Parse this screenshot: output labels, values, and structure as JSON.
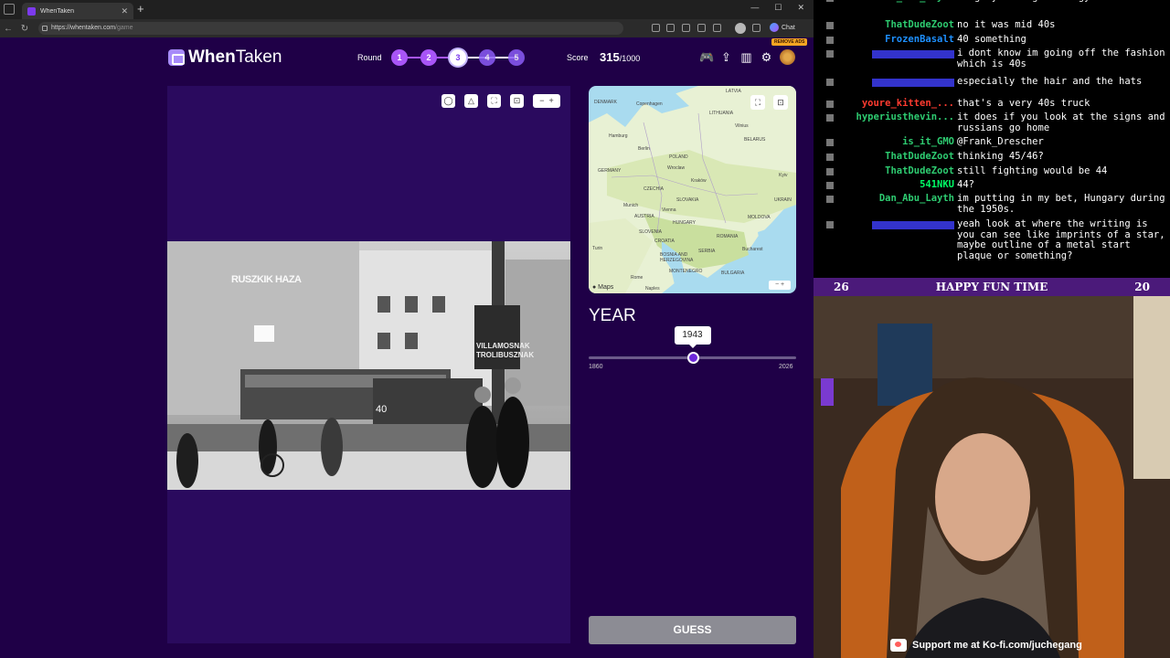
{
  "browser": {
    "tab_title": "WhenTaken",
    "url_prefix": "https://whentaken.com",
    "url_path": "/game",
    "chat_label": "Chat",
    "remove_ads": "REMOVE ADS"
  },
  "header": {
    "logo_bold": "When",
    "logo_light": "Taken",
    "round_label": "Round",
    "rounds": [
      "1",
      "2",
      "3",
      "4",
      "5"
    ],
    "current_round": 3,
    "score_label": "Score",
    "score_value": "315",
    "score_max": "/1000"
  },
  "photo": {
    "sign_top": "RUSZKIK HAZA",
    "sign_shop": "VILLAMOSNAK TROLIBUSZNAK",
    "tram_text": "40"
  },
  "map": {
    "attribution": " Maps",
    "labels": [
      "Copenhagen",
      "LATVIA",
      "LITHUANIA",
      "Hamburg",
      "Berlin",
      "BELARUS",
      "POLAND",
      "GERMANY",
      "Wroclaw",
      "Kraków",
      "CZECHIA",
      "Kyiv",
      "Munich",
      "SLOVAKIA",
      "Vienna",
      "UKRAIN",
      "AUSTRIA",
      "HUNGARY",
      "MOLDOVA",
      "SLOVENIA",
      "CROATIA",
      "ROMANIA",
      "Turin",
      "BOSNIA AND HERZEGOVINA",
      "SERBIA",
      "Bucharest",
      "Rome",
      "MONTENEGRO",
      "BULGARIA",
      "Naples",
      "DENMARK",
      "Vilnius"
    ]
  },
  "year": {
    "label": "YEAR",
    "selected": "1943",
    "min": "1860",
    "max": "2026",
    "value_fraction": 0.5
  },
  "guess_label": "GUESS",
  "stream": {
    "chat": [
      {
        "user": "Dan_Abu_Layth",
        "color": "#2ecc71",
        "text": "Hungary during the Nagy Years?"
      },
      {
        "user": "ThatDudeZoot",
        "color": "#2ecc71",
        "text": "no it was mid 40s"
      },
      {
        "user": "FrozenBasalt",
        "color": "#1e90ff",
        "text": "40 something"
      },
      {
        "user": "",
        "color": "#3333cc",
        "text": "i dont know im going off the fashion which is 40s"
      },
      {
        "user": "",
        "color": "#3333cc",
        "text": "especially the hair and the hats"
      },
      {
        "user": "youre_kitten_...",
        "color": "#ff3b30",
        "text": "that's a very 40s truck"
      },
      {
        "user": "hyperiusthevin...",
        "color": "#2ecc71",
        "text": "it does if you look at the signs and russians go home"
      },
      {
        "user": "is_it_GMO",
        "color": "#2ecc71",
        "text": "@Frank_Drescher"
      },
      {
        "user": "ThatDudeZoot",
        "color": "#2ecc71",
        "text": "thinking 45/46?"
      },
      {
        "user": "ThatDudeZoot",
        "color": "#2ecc71",
        "text": "still fighting would be 44"
      },
      {
        "user": "541NKU",
        "color": "#00ff66",
        "text": "44?"
      },
      {
        "user": "Dan_Abu_Layth",
        "color": "#2ecc71",
        "text": "im putting in my bet, Hungary during the 1950s."
      },
      {
        "user": "",
        "color": "#3333cc",
        "text": "yeah look at where the writing is you can see like imprints of a star, maybe outline of a metal start plaque or something?"
      }
    ],
    "banner_left": "26",
    "banner_title": "HAPPY FUN TIME",
    "banner_right": "20",
    "support_text": "Support me at Ko-fi.com/juchegang"
  }
}
